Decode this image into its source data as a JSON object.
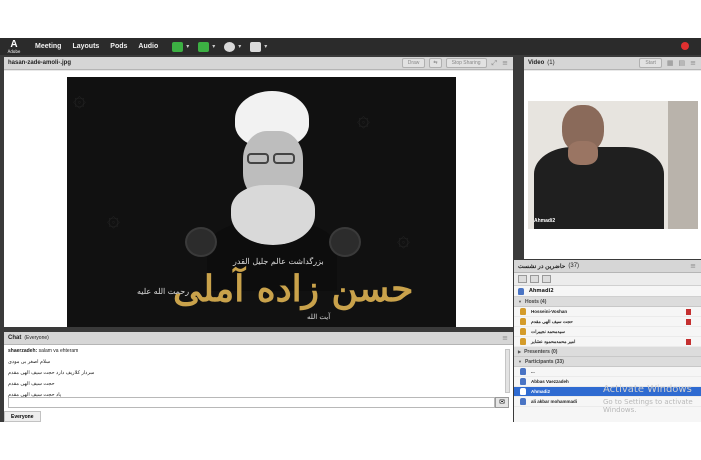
{
  "menubar": {
    "logo_text": "A",
    "logo_sub": "Adobe",
    "items": [
      "Meeting",
      "Layouts",
      "Pods",
      "Audio"
    ],
    "colors": {
      "speaker": "#3cb043",
      "mic": "#3cb043",
      "record": "#e03030"
    }
  },
  "share_pod": {
    "title": "hasan-zade-amoli-.jpg",
    "draw_label": "Draw",
    "stop_label": "Stop Sharing",
    "image": {
      "title": "حسن زاده آملی",
      "line1": "بزرگداشت عالم جلیل القدر",
      "line2": "آیت الله",
      "line3": "رحمت الله علیه"
    }
  },
  "video_pod": {
    "title": "Video",
    "count": "(1)",
    "start_label": "Start",
    "camera_name": "Ahmadi2"
  },
  "attendees_pod": {
    "title": "حاضرین در نشست",
    "count": "(37)",
    "me": "Ahmadi2",
    "hosts_header": "Hosts (4)",
    "hosts": [
      "Hosseini-Voshan",
      "حجت سیف الهی مقدم",
      "سیدمحمد نجیبرات",
      "امیر محمدمحمود عشایر"
    ],
    "presenters_header": "Presenters (0)",
    "participants_header": "Participants (33)",
    "participants": [
      "...",
      "Abbas Vaezzadeh",
      "Ahmadi2",
      "ali akbar mohammadi"
    ]
  },
  "chat_pod": {
    "title": "Chat",
    "scope": "(Everyone)",
    "messages": [
      {
        "name": "shaerzadeh:",
        "text": "salam va ehteram"
      },
      {
        "name": "",
        "text": "سلام اصغر بی مودی"
      },
      {
        "name": "",
        "text": "سردار کلاریف دارد حجت سیف الهی مقدم"
      },
      {
        "name": "",
        "text": "حجت سیف الهی مقدم"
      },
      {
        "name": "",
        "text": "یاد حجت سیف الهی مقدم"
      }
    ],
    "input_placeholder": "",
    "tab_label": "Everyone"
  },
  "watermark": {
    "line1": "Activate Windows",
    "line2": "Go to Settings to activate Windows."
  }
}
